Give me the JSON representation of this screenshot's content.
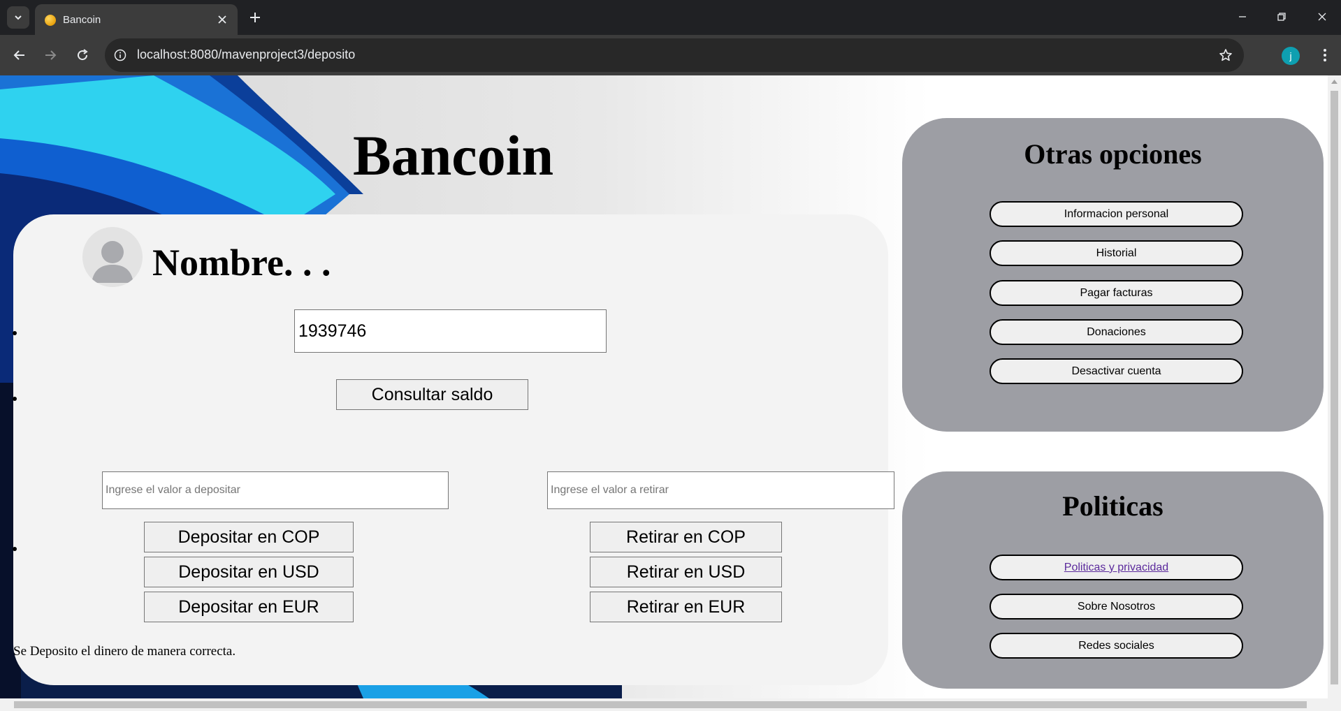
{
  "browser": {
    "tab_title": "Bancoin",
    "url": "localhost:8080/mavenproject3/deposito",
    "profile_initial": "j"
  },
  "page": {
    "title": "Bancoin",
    "user_name": "Nombre. . .",
    "account_value": "1939746",
    "check_balance_label": "Consultar saldo",
    "deposit_placeholder": "Ingrese el valor a depositar",
    "withdraw_placeholder": "Ingrese el valor a retirar",
    "deposit_buttons": [
      "Depositar en COP",
      "Depositar en USD",
      "Depositar en EUR"
    ],
    "withdraw_buttons": [
      "Retirar en COP",
      "Retirar en USD",
      "Retirar en EUR"
    ],
    "status_message": "Se Deposito el dinero de manera correcta."
  },
  "other_options": {
    "title": "Otras opciones",
    "items": [
      "Informacion personal",
      "Historial",
      "Pagar facturas",
      "Donaciones",
      "Desactivar cuenta"
    ]
  },
  "policies": {
    "title": "Politicas",
    "items": [
      "Politicas y privacidad",
      "Sobre Nosotros",
      "Redes sociales"
    ]
  },
  "colors": {
    "side_panel": "#9d9ea4",
    "main_card": "#f3f3f3",
    "link": "#5b2a9c"
  }
}
